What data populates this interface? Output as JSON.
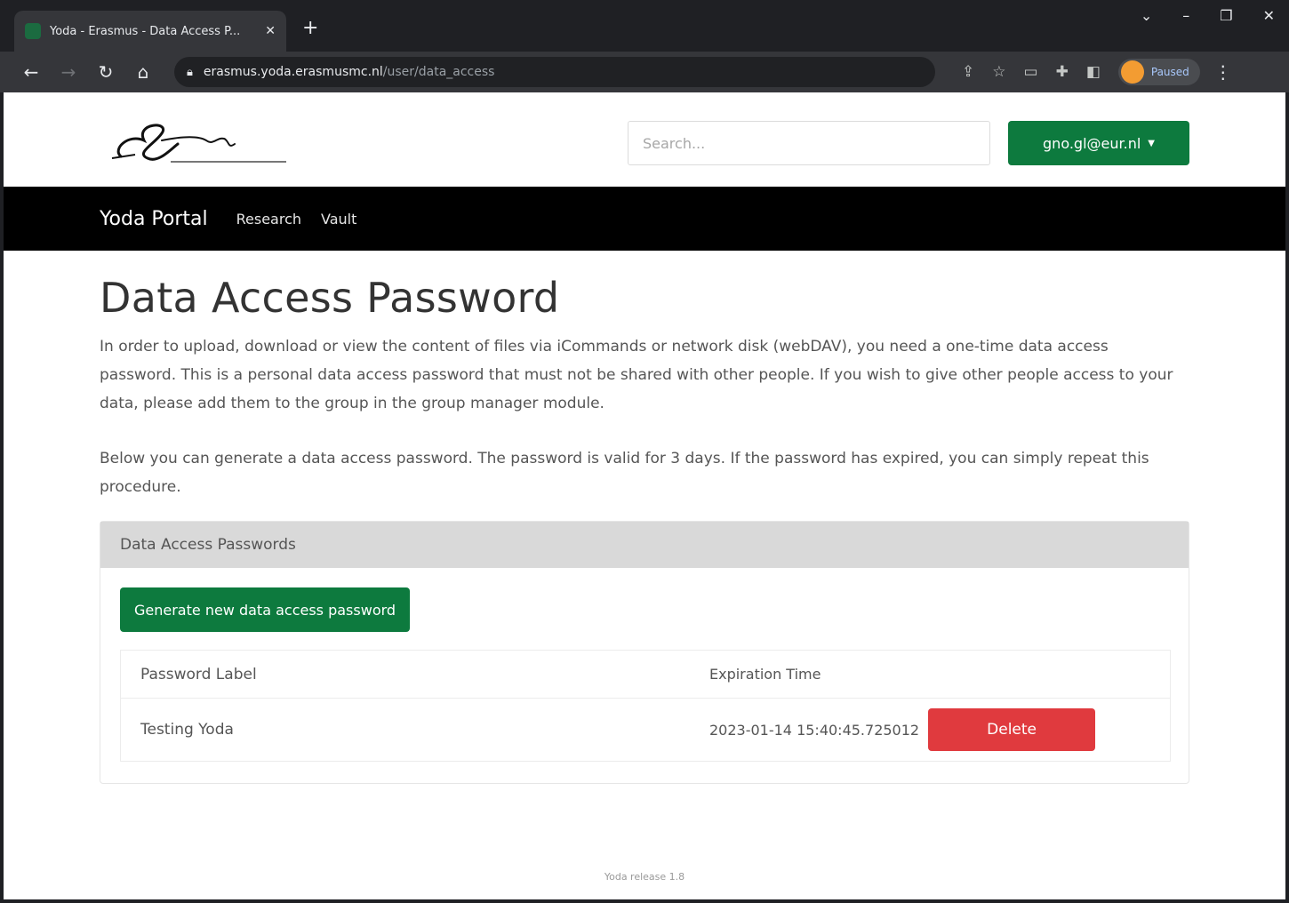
{
  "browser": {
    "tab_title": "Yoda - Erasmus - Data Access P...",
    "new_tab_glyph": "+",
    "tab_close_glyph": "✕",
    "url_host": "erasmus.yoda.erasmusmc.nl",
    "url_path": "/user/data_access",
    "profile_label": "Paused",
    "icons": [
      "back-icon",
      "forward-icon",
      "reload-icon",
      "home-icon",
      "lock-icon",
      "share-icon",
      "star-icon",
      "extension-icon",
      "puzzle-icon",
      "sidepanel-icon",
      "menu-icon"
    ]
  },
  "header": {
    "search_placeholder": "Search...",
    "user_label": "gno.gl@eur.nl"
  },
  "nav": {
    "brand": "Yoda Portal",
    "items": [
      "Research",
      "Vault"
    ]
  },
  "main": {
    "title": "Data Access Password",
    "paragraph1": "In order to upload, download or view the content of files via iCommands or network disk (webDAV), you need a one-time data access password. This is a personal data access password that must not be shared with other people. If you wish to give other people access to your data, please add them to the group in the group manager module.",
    "paragraph2": "Below you can generate a data access password. The password is valid for 3 days. If the password has expired, you can simply repeat this procedure.",
    "card": {
      "header": "Data Access Passwords",
      "generate_label": "Generate new data access password",
      "columns": [
        "Password Label",
        "Expiration Time"
      ],
      "rows": [
        {
          "label": "Testing Yoda",
          "expiration": "2023-01-14 15:40:45.725012",
          "action": "Delete"
        }
      ]
    }
  },
  "footer": {
    "text": "Yoda release 1.8"
  },
  "colors": {
    "accent_green": "#0d7a3e",
    "danger_red": "#e03a3e"
  }
}
